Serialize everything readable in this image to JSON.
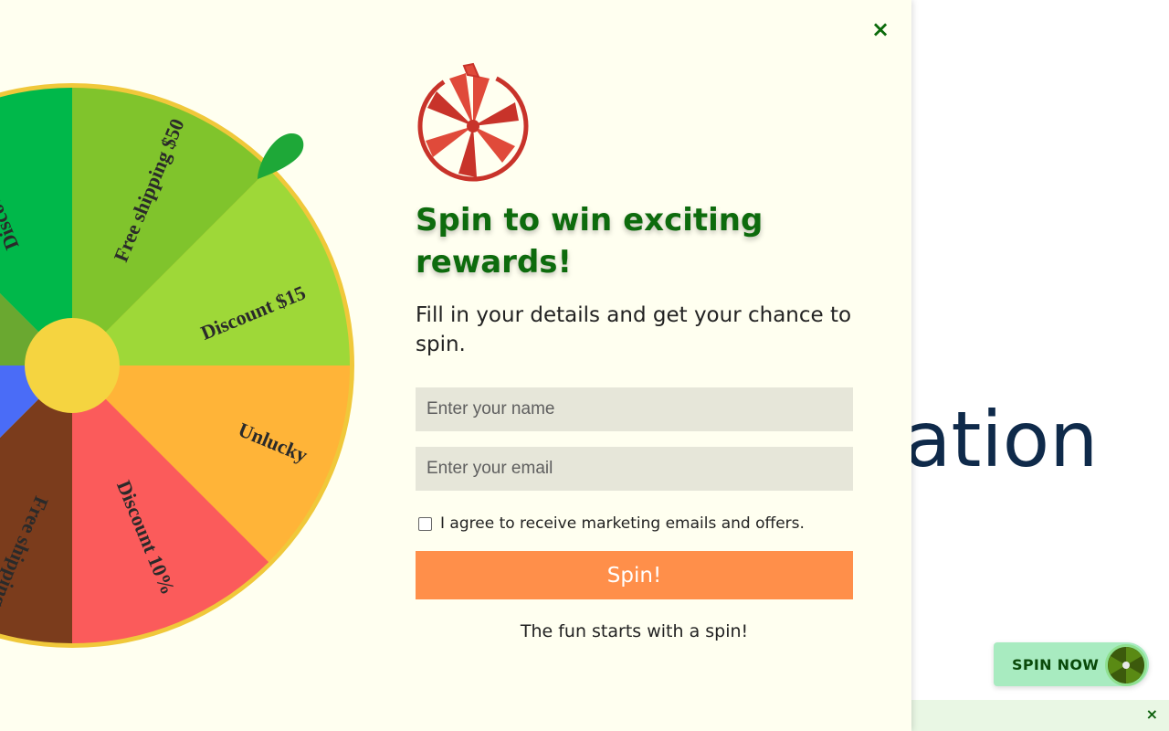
{
  "background": {
    "heading_fragment": "ation",
    "spin_now_label": "SPIN NOW",
    "bottom_bar_close": "×"
  },
  "popup": {
    "close_label": "×",
    "title": "Spin to win exciting rewards!",
    "subtitle": "Fill in your details and get your chance to spin.",
    "name_placeholder": "Enter your name",
    "email_placeholder": "Enter your email",
    "consent_label": "I agree to receive marketing emails and offers.",
    "spin_button": "Spin!",
    "footer_text": "The fun starts with a spin!"
  },
  "wheel": {
    "segments": [
      {
        "label": "Discount $15",
        "color": "#9ed838"
      },
      {
        "label": "Unlucky",
        "color": "#ffb438"
      },
      {
        "label": "Discount 10%",
        "color": "#fb5b5b"
      },
      {
        "label": "Free shipping",
        "color": "#7b3c1c"
      },
      {
        "label": "Discount",
        "color": "#00b84a"
      },
      {
        "label": "Free shipping $50",
        "color": "#80c42c"
      }
    ],
    "rim_color": "#f0c83a",
    "hub_color": "#f5d440",
    "pointer_color": "#1ea838"
  },
  "colors": {
    "title": "#0d6b0d",
    "spin_button": "#ff8f4a",
    "popup_bg": "#fffff0",
    "background_heading": "#0f2a4a"
  },
  "icons": {
    "popup_close": "close-icon",
    "logo": "spin-wheel-logo-icon",
    "pointer": "wheel-pointer-icon",
    "mini_wheel": "mini-wheel-icon",
    "bottom_close": "close-icon"
  }
}
